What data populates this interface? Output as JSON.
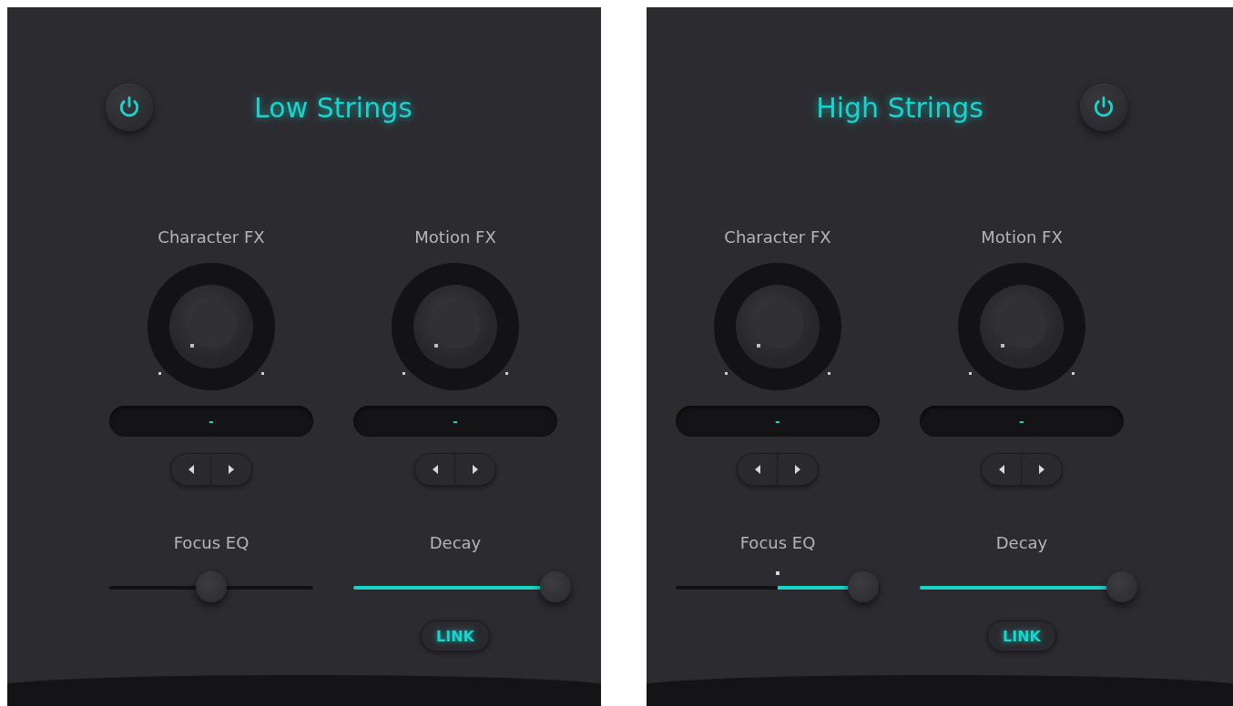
{
  "panels": [
    {
      "header": [
        {
          "kind": "power",
          "on": true
        },
        {
          "kind": "title",
          "text": "Low Strings"
        }
      ],
      "knobs": [
        {
          "label": "Character FX",
          "readout": "-"
        },
        {
          "label": "Motion FX",
          "readout": "-"
        }
      ],
      "sliders": [
        {
          "label": "Focus EQ",
          "kind": "bipolar",
          "level": 0.5
        },
        {
          "label": "Decay",
          "kind": "unipolar",
          "level": 0.99,
          "link": {
            "label": "LINK",
            "on": true
          }
        }
      ]
    },
    {
      "header": [
        {
          "kind": "title",
          "text": "High Strings"
        },
        {
          "kind": "power",
          "on": true
        }
      ],
      "knobs": [
        {
          "label": "Character FX",
          "readout": "-"
        },
        {
          "label": "Motion FX",
          "readout": "-"
        }
      ],
      "sliders": [
        {
          "label": "Focus EQ",
          "kind": "bipolar",
          "level": 0.92
        },
        {
          "label": "Decay",
          "kind": "unipolar",
          "level": 0.99,
          "link": {
            "label": "LINK",
            "on": true
          }
        }
      ]
    }
  ]
}
